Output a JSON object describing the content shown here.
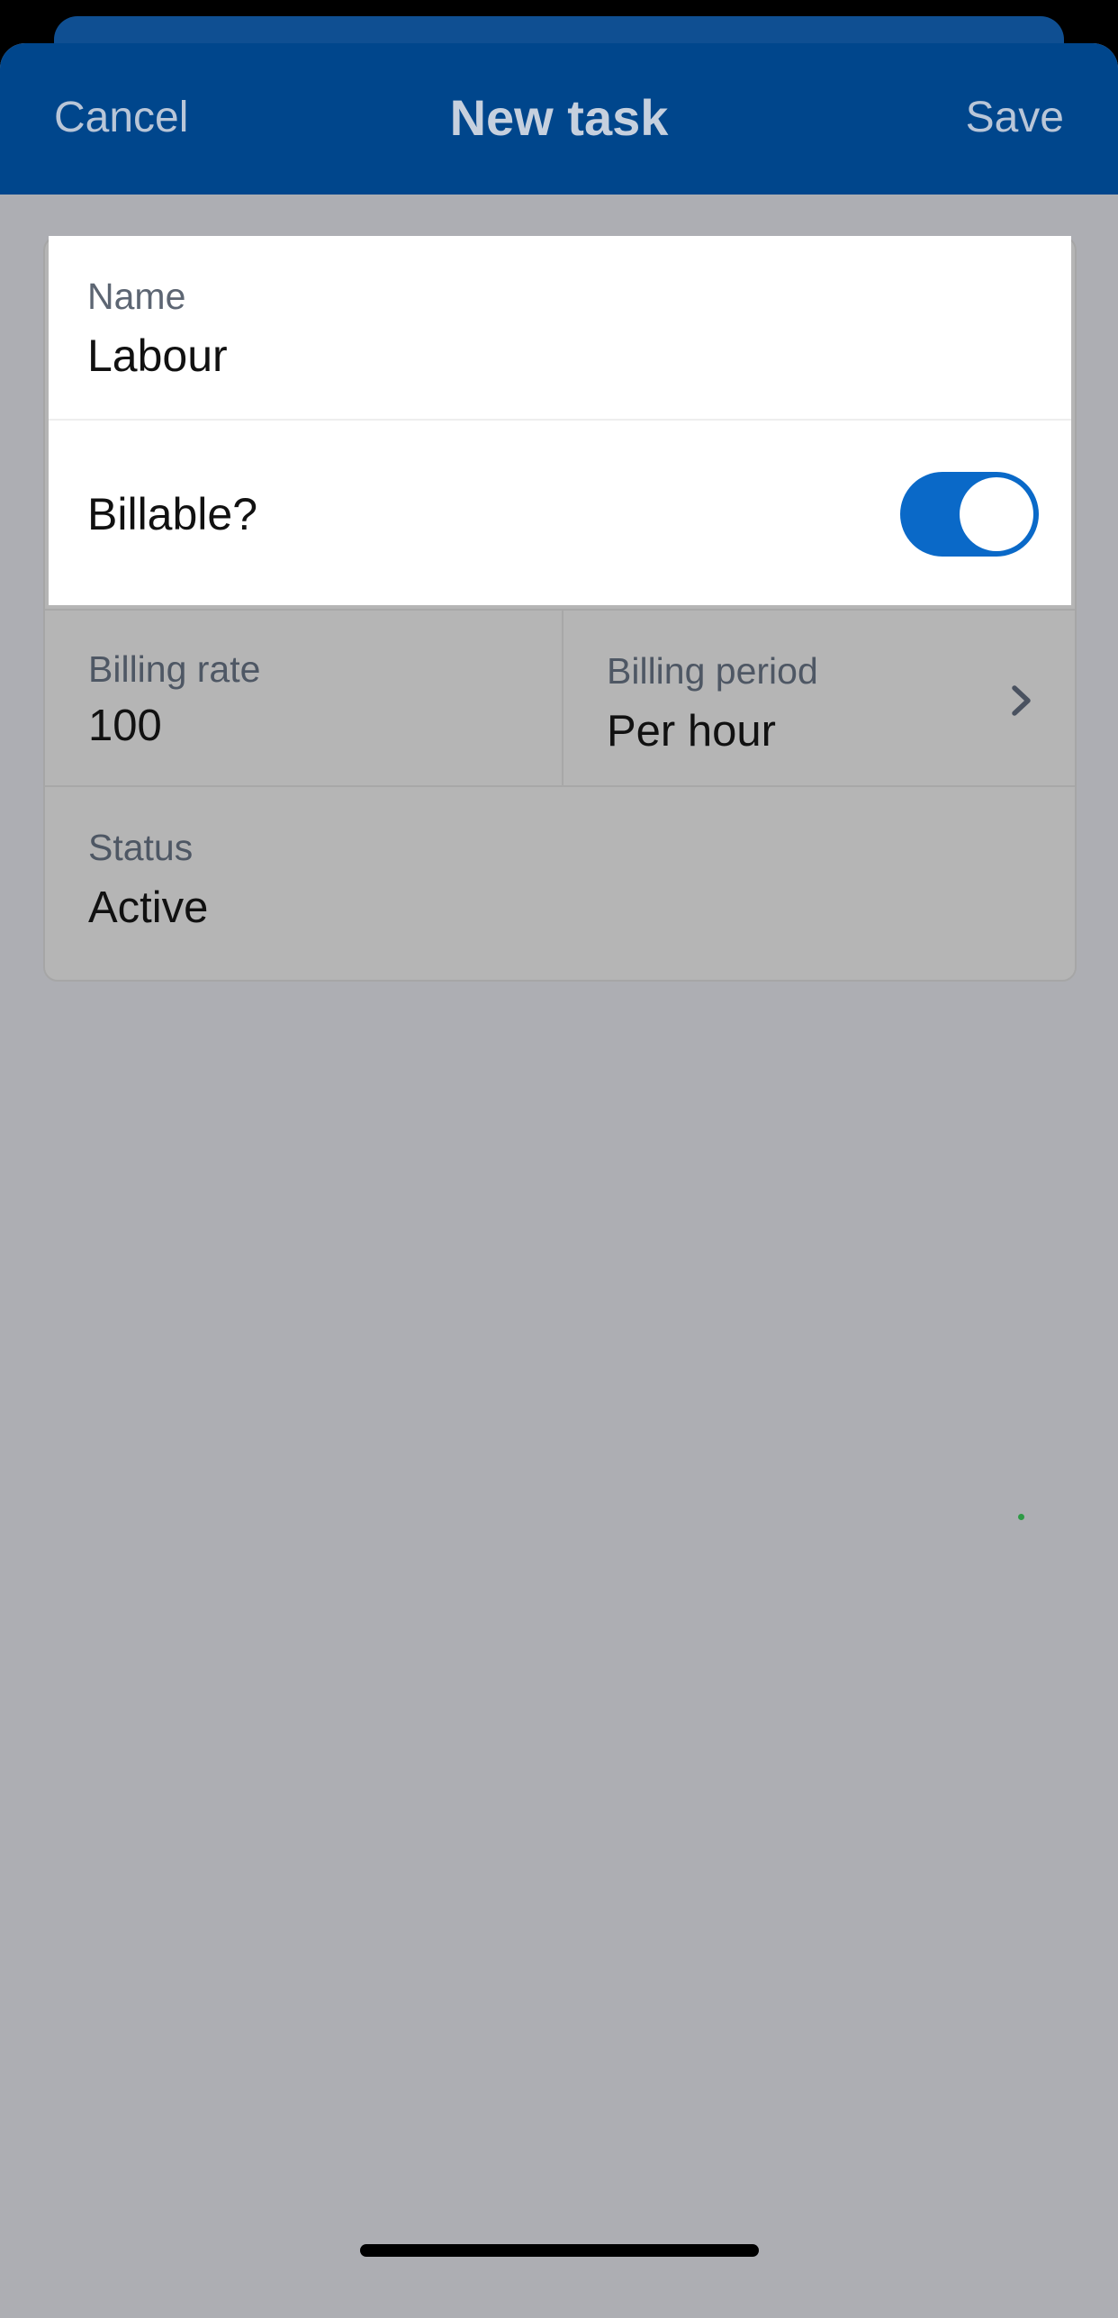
{
  "navbar": {
    "cancel_label": "Cancel",
    "title": "New task",
    "save_label": "Save"
  },
  "form": {
    "name": {
      "label": "Name",
      "value": "Labour"
    },
    "billable": {
      "label": "Billable?",
      "enabled": true
    },
    "billing_rate": {
      "label": "Billing rate",
      "value": "100"
    },
    "billing_period": {
      "label": "Billing period",
      "value": "Per hour"
    },
    "status": {
      "label": "Status",
      "value": "Active"
    }
  },
  "icons": {
    "billing_period_chevron": "chevron-right-icon"
  },
  "colors": {
    "navbar_bg": "#00468c",
    "toggle_on": "#0a69c8",
    "overlay_bg": "#adaeb3"
  }
}
